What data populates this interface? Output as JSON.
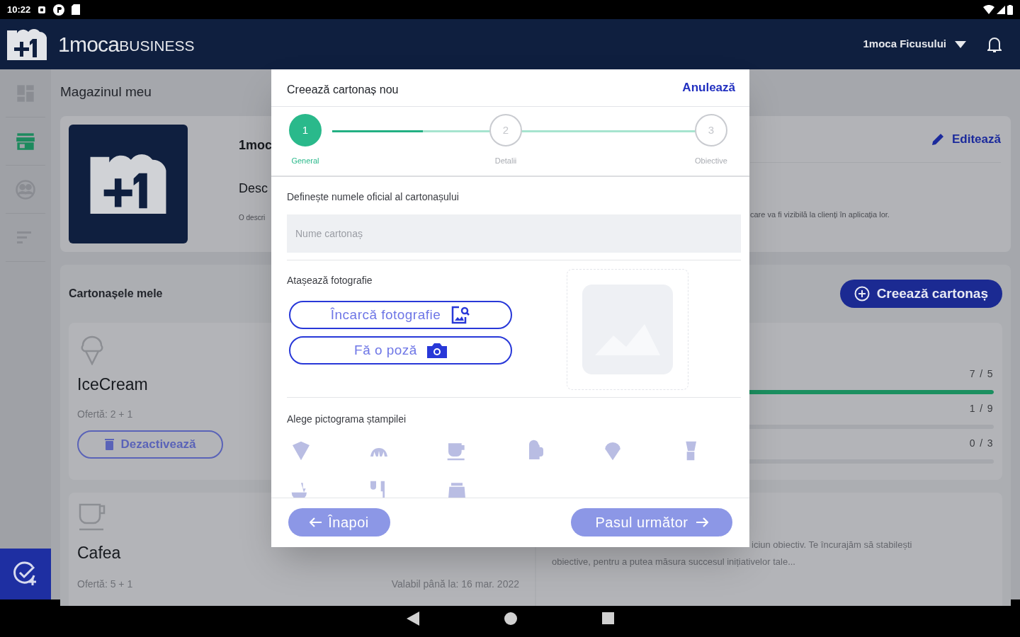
{
  "status_bar": {
    "time": "10:22"
  },
  "header": {
    "brand_main": "1moca",
    "brand_suffix": "BUSINESS",
    "store_selector": "1moca Ficusului"
  },
  "sidebar": {
    "items": [
      {
        "selected": false
      },
      {
        "selected": true
      },
      {
        "selected": false
      },
      {
        "selected": false
      }
    ]
  },
  "page_title": "Magazinul meu",
  "store_card": {
    "name": "1moc",
    "description_label": "Desc",
    "description_start": "O descri",
    "description_end": "care va fi vizibilă la clienți în aplicația lor.",
    "edit_button": "Editează"
  },
  "cards_section": {
    "title": "Cartonașele mele",
    "create_button": "Creează cartonaș"
  },
  "stamp_cards": [
    {
      "name": "IceCream",
      "offer": "Ofertă: 2 + 1",
      "action": "Dezactivează"
    },
    {
      "name": "Cafea",
      "offer": "Ofertă: 5 + 1",
      "validity": "Valabil până la: 16 mar. 2022"
    }
  ],
  "objectives": [
    {
      "reading": "7 / 5",
      "level": 1
    },
    {
      "reading": "1 / 9",
      "level": 0
    },
    {
      "reading": "0 / 3",
      "level": 0
    }
  ],
  "objectives_note": [
    "iciun obiectiv. Te încurajăm să stabilești",
    "obiective, pentru a putea măsura succesul inițiativelor tale..."
  ],
  "dialog": {
    "title": "Creează cartonaș nou",
    "cancel": "Anulează",
    "steps": [
      {
        "number": "1",
        "label": "General",
        "selected": true
      },
      {
        "number": "2",
        "label": "Detalii",
        "selected": false
      },
      {
        "number": "3",
        "label": "Obiective",
        "selected": false
      }
    ],
    "stepper": {
      "level": 0.25
    },
    "name_field": {
      "label": "Definește numele oficial al cartonașului",
      "placeholder": "Nume cartonaș"
    },
    "photo": {
      "label": "Atașează fotografie",
      "upload_button": "Încarcă fotografie",
      "camera_button": "Fă o poză"
    },
    "stamp_icons": {
      "label": "Alege pictograma ștampilei",
      "items": [
        {
          "selected": false
        },
        {
          "selected": false
        },
        {
          "selected": false
        },
        {
          "selected": false
        },
        {
          "selected": false
        },
        {
          "selected": false
        },
        {
          "selected": false
        },
        {
          "selected": false
        },
        {
          "selected": false
        }
      ]
    },
    "back_button": "Înapoi",
    "next_button": "Pasul următor"
  }
}
